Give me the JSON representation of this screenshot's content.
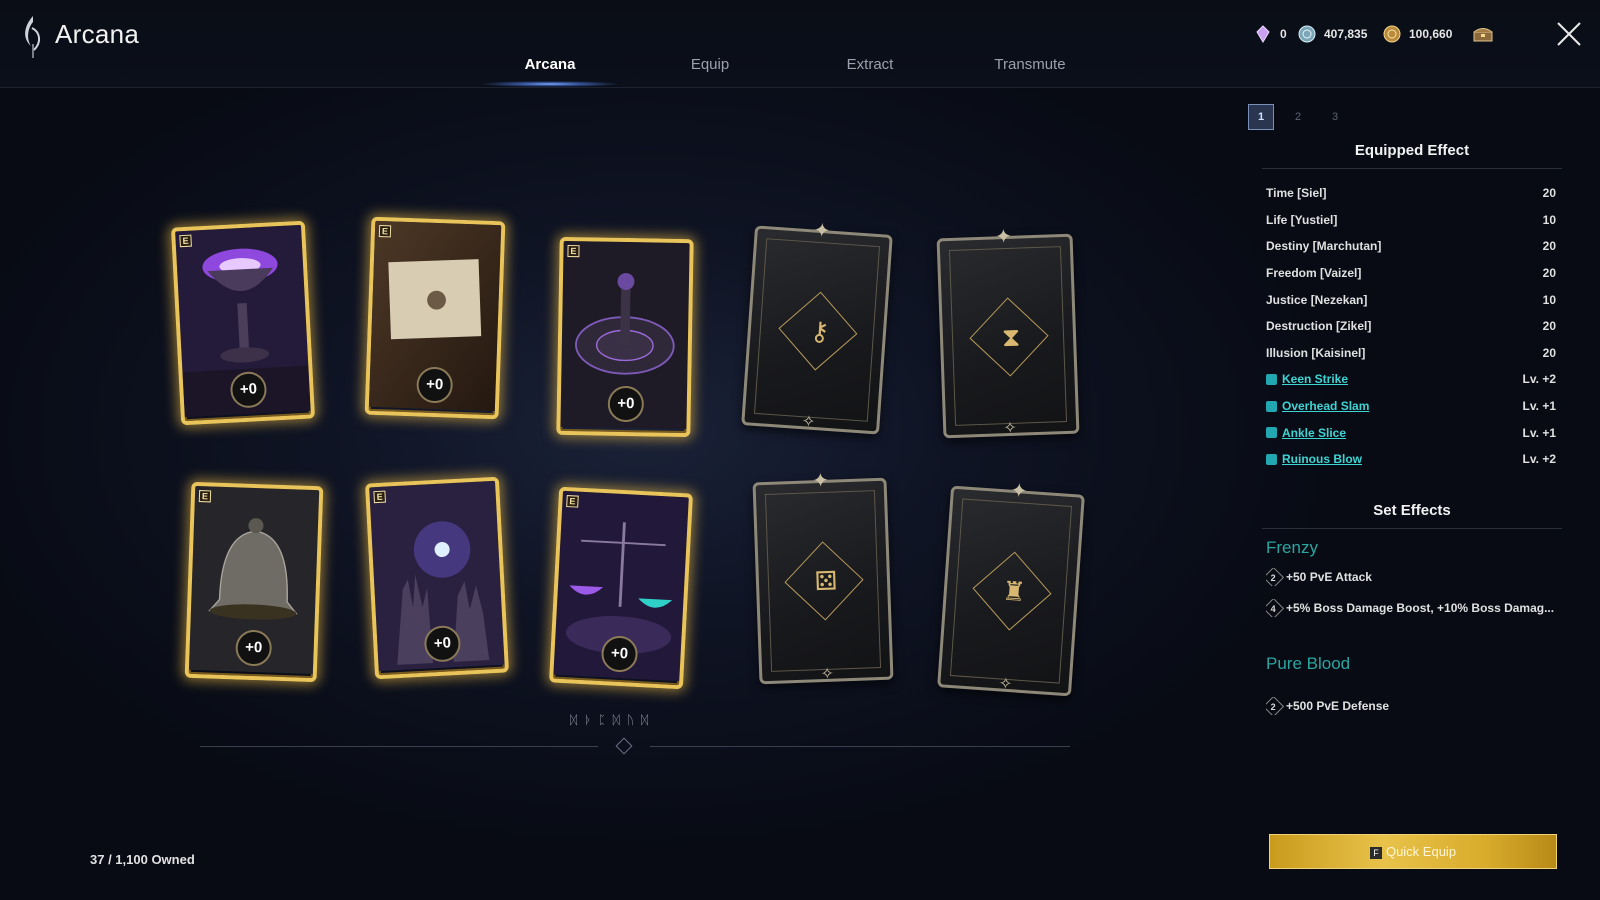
{
  "header": {
    "title": "Arcana",
    "tabs": [
      "Arcana",
      "Equip",
      "Extract",
      "Transmute"
    ],
    "active_tab": "Arcana",
    "currencies": [
      {
        "icon": "crystal-icon",
        "value": "0"
      },
      {
        "icon": "silver-coin-icon",
        "value": "407,835"
      },
      {
        "icon": "gold-coin-icon",
        "value": "100,660"
      },
      {
        "icon": "chest-icon",
        "value": ""
      }
    ]
  },
  "cards": [
    {
      "state": "filled",
      "grade": "E",
      "level": "+0",
      "art": "chalice"
    },
    {
      "state": "filled",
      "grade": "E",
      "level": "+0",
      "art": "scroll"
    },
    {
      "state": "filled",
      "grade": "E",
      "level": "+0",
      "art": "wheel"
    },
    {
      "state": "empty",
      "icon": "key-icon"
    },
    {
      "state": "empty",
      "icon": "hourglass-icon"
    },
    {
      "state": "filled",
      "grade": "E",
      "level": "+0",
      "art": "bell"
    },
    {
      "state": "filled",
      "grade": "E",
      "level": "+0",
      "art": "hands"
    },
    {
      "state": "filled",
      "grade": "E",
      "level": "+0",
      "art": "scales"
    },
    {
      "state": "empty",
      "icon": "dice-icon"
    },
    {
      "state": "empty",
      "icon": "lantern-icon"
    }
  ],
  "owned": "37 / 1,100 Owned",
  "panel": {
    "pages": [
      "1",
      "2",
      "3"
    ],
    "active_page": "1",
    "equipped_title": "Equipped Effect",
    "equipped": [
      {
        "name": "Time [Siel]",
        "value": "20",
        "skill": false
      },
      {
        "name": "Life [Yustiel]",
        "value": "10",
        "skill": false
      },
      {
        "name": "Destiny [Marchutan]",
        "value": "20",
        "skill": false
      },
      {
        "name": "Freedom [Vaizel]",
        "value": "20",
        "skill": false
      },
      {
        "name": "Justice [Nezekan]",
        "value": "10",
        "skill": false
      },
      {
        "name": "Destruction [Zikel]",
        "value": "20",
        "skill": false
      },
      {
        "name": "Illusion [Kaisinel]",
        "value": "20",
        "skill": false
      },
      {
        "name": "Keen Strike",
        "value": "Lv. +2",
        "skill": true
      },
      {
        "name": "Overhead Slam",
        "value": "Lv. +1",
        "skill": true
      },
      {
        "name": "Ankle Slice",
        "value": "Lv. +1",
        "skill": true
      },
      {
        "name": "Ruinous Blow",
        "value": "Lv. +2",
        "skill": true
      }
    ],
    "set_title": "Set Effects",
    "sets": [
      {
        "name": "Frenzy",
        "effects": [
          {
            "count": "2",
            "text": "+50 PvE Attack"
          },
          {
            "count": "4",
            "text": "+5% Boss Damage Boost, +10% Boss Damag..."
          }
        ]
      },
      {
        "name": "Pure Blood",
        "effects": [
          {
            "count": "2",
            "text": "+500 PvE Defense"
          }
        ]
      }
    ],
    "quick_equip_key": "F",
    "quick_equip_label": "Quick Equip"
  }
}
